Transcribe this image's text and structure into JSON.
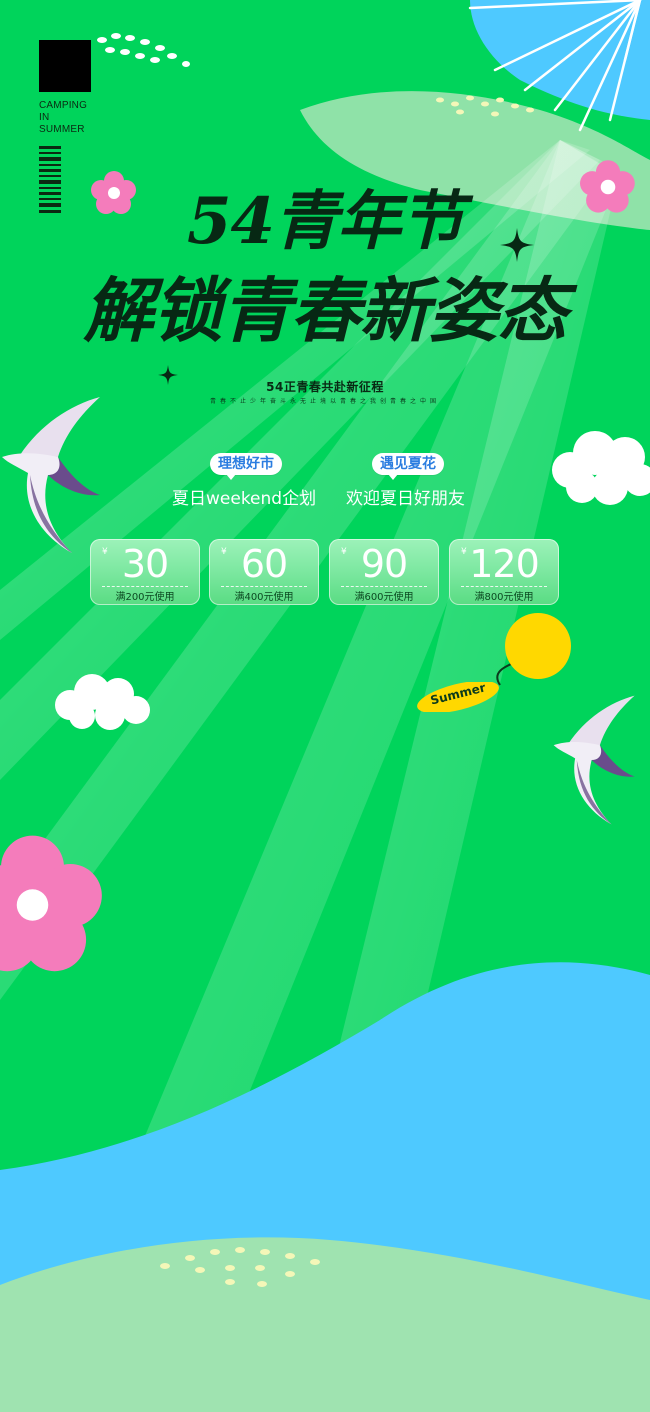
{
  "brand": {
    "lines": [
      "CAMPING",
      "IN",
      "SUMMER"
    ]
  },
  "title": {
    "line1": "54青年节",
    "line2": "解锁青春新姿态"
  },
  "subtitle": "54正青春共赴新征程",
  "tagline": "青春不止少年奋斗永无止境以青春之我创青春之中国",
  "labels": [
    {
      "pill": "理想好市",
      "desc": "夏日weekend企划"
    },
    {
      "pill": "遇见夏花",
      "desc": "欢迎夏日好朋友"
    }
  ],
  "coupons": [
    {
      "currency": "¥",
      "amount": "30",
      "condition": "满200元使用"
    },
    {
      "currency": "¥",
      "amount": "60",
      "condition": "满400元使用"
    },
    {
      "currency": "¥",
      "amount": "90",
      "condition": "满600元使用"
    },
    {
      "currency": "¥",
      "amount": "120",
      "condition": "满800元使用"
    }
  ],
  "summer_tag": "Summer",
  "colors": {
    "background_green": "#00d45b",
    "sky_blue": "#4ec9ff",
    "pale_green": "#9fe3b0",
    "title_dark": "#072814",
    "pill_text_blue": "#2b7de0",
    "flower_pink": "#f47cbb",
    "sun_yellow": "#ffd800"
  },
  "icons": [
    "swallow-bird-icon",
    "cloud-icon",
    "flower-icon",
    "sparkle-star-icon",
    "sun-icon",
    "barcode-icon"
  ]
}
